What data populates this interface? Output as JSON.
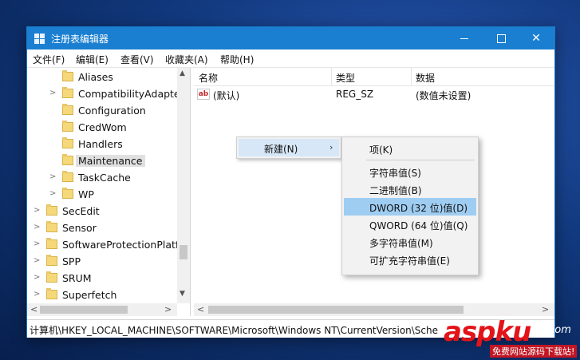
{
  "window": {
    "title": "注册表编辑器",
    "controls": {
      "minimize": "",
      "maximize": "",
      "close": "✕"
    }
  },
  "menubar": {
    "items": [
      "文件(F)",
      "编辑(E)",
      "查看(V)",
      "收藏夹(A)",
      "帮助(H)"
    ]
  },
  "tree": {
    "items": [
      {
        "label": "Aliases",
        "expandable": false
      },
      {
        "label": "CompatibilityAdapte",
        "expandable": true
      },
      {
        "label": "Configuration",
        "expandable": false
      },
      {
        "label": "CredWom",
        "expandable": false
      },
      {
        "label": "Handlers",
        "expandable": false
      },
      {
        "label": "Maintenance",
        "expandable": false,
        "selected": true
      },
      {
        "label": "TaskCache",
        "expandable": true
      },
      {
        "label": "WP",
        "expandable": true
      },
      {
        "label": "SecEdit",
        "expandable": true
      },
      {
        "label": "Sensor",
        "expandable": true
      },
      {
        "label": "SoftwareProtectionPlatf",
        "expandable": true
      },
      {
        "label": "SPP",
        "expandable": true
      },
      {
        "label": "SRUM",
        "expandable": true
      },
      {
        "label": "Superfetch",
        "expandable": true
      }
    ]
  },
  "list": {
    "columns": [
      "名称",
      "类型",
      "数据"
    ],
    "rows": [
      {
        "icon": "ab",
        "name": "(默认)",
        "type": "REG_SZ",
        "data": "(数值未设置)"
      }
    ]
  },
  "status_path": "计算机\\HKEY_LOCAL_MACHINE\\SOFTWARE\\Microsoft\\Windows NT\\CurrentVersion\\Sche",
  "context_menu": {
    "new_label": "新建(N)",
    "new_arrow": "›",
    "submenu": {
      "key": "项(K)",
      "items": [
        "字符串值(S)",
        "二进制值(B)",
        "DWORD (32 位)值(D)",
        "QWORD (64 位)值(Q)",
        "多字符串值(M)",
        "可扩充字符串值(E)"
      ],
      "highlighted_index": 2
    }
  },
  "watermark": {
    "logo": "aspku",
    "dotcom": ".com",
    "tagline": "免费网站源码下载站!"
  },
  "colors": {
    "titlebar": "#1a7fd1",
    "highlight": "#9fcdf2",
    "watermark_red": "#e3131a"
  }
}
